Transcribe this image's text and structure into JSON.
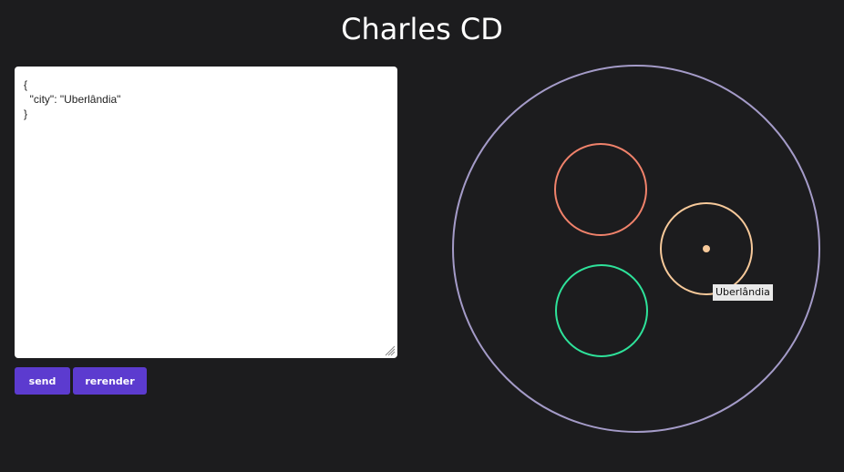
{
  "app": {
    "title": "Charles CD"
  },
  "editor": {
    "value": "{\n  \"city\": \"Uberlândia\"\n}"
  },
  "buttons": {
    "send_label": "send",
    "rerender_label": "rerender"
  },
  "visualization": {
    "outer_circle_color": "#a49bc8",
    "circles": [
      {
        "name": "coral",
        "color": "#f0826b"
      },
      {
        "name": "peach",
        "color": "#f7c99a",
        "has_dot": true
      },
      {
        "name": "green",
        "color": "#2ee29a"
      }
    ],
    "tooltip": "Uberlândia"
  },
  "colors": {
    "background": "#1c1c1e",
    "accent": "#5c3bcf"
  }
}
